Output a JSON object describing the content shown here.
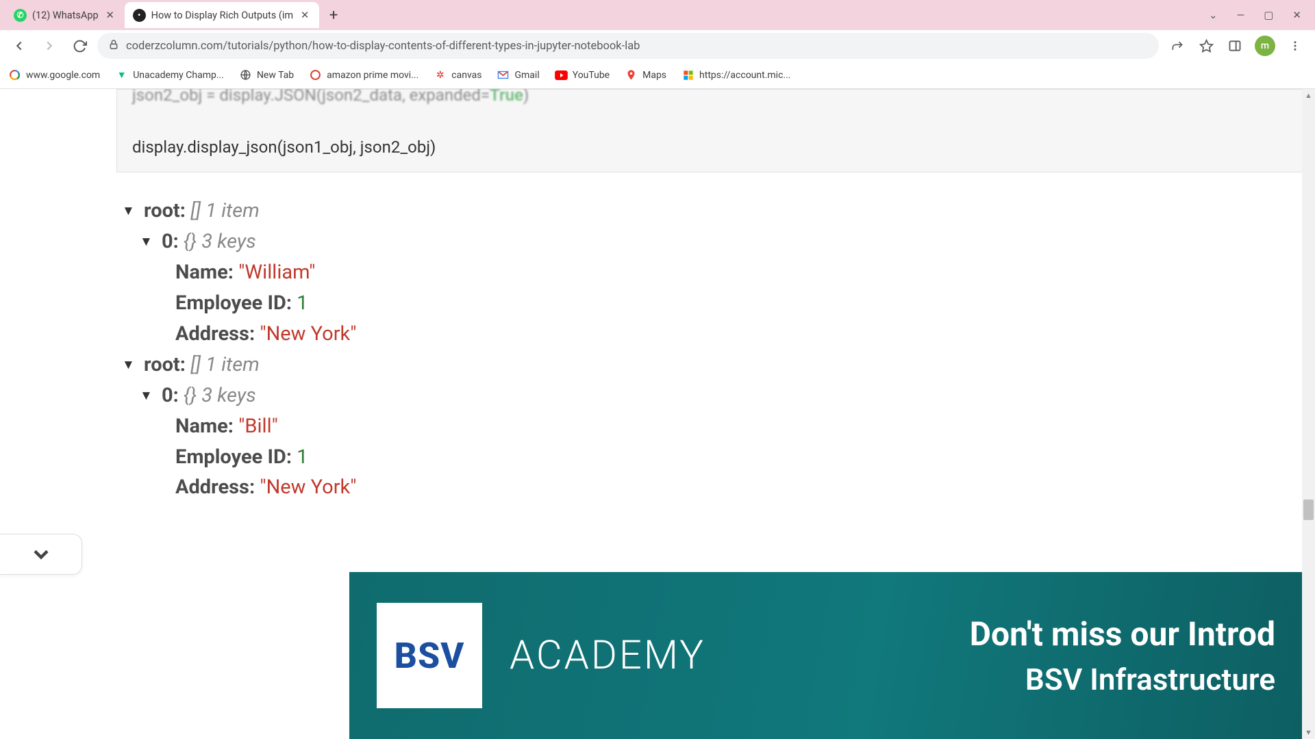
{
  "tabs": [
    {
      "title": "(12) WhatsApp",
      "favicon_bg": "#25d366",
      "favicon_text": "⊕"
    },
    {
      "title": "How to Display Rich Outputs (im",
      "favicon_bg": "#222",
      "favicon_text": "●"
    }
  ],
  "addr": {
    "url": "coderzcolumn.com/tutorials/python/how-to-display-contents-of-different-types-in-jupyter-notebook-lab"
  },
  "avatar_letter": "m",
  "bookmarks": [
    {
      "label": "www.google.com"
    },
    {
      "label": "Unacademy Champ..."
    },
    {
      "label": "New Tab"
    },
    {
      "label": "amazon prime movi..."
    },
    {
      "label": "canvas"
    },
    {
      "label": "Gmail"
    },
    {
      "label": "YouTube"
    },
    {
      "label": "Maps"
    },
    {
      "label": "https://account.mic..."
    }
  ],
  "code": {
    "blur_line_a": "json2_obj = display.JSON(json2_data, expanded=",
    "blur_true": "True",
    "blur_line_b": ")",
    "line2": "display.display_json(json1_obj, json2_obj)"
  },
  "json": {
    "root_label": "root:",
    "root_br": "[]",
    "root_meta": "1 item",
    "idx_label": "0:",
    "idx_br": "{}",
    "idx_meta": "3 keys",
    "obj1": {
      "name_k": "Name:",
      "name_v": "\"William\"",
      "eid_k": "Employee ID:",
      "eid_v": "1",
      "addr_k": "Address:",
      "addr_v": "\"New York\""
    },
    "obj2": {
      "name_k": "Name:",
      "name_v": "\"Bill\"",
      "eid_k": "Employee ID:",
      "eid_v": "1",
      "addr_k": "Address:",
      "addr_v": "\"New York\""
    }
  },
  "ad": {
    "logo": "BSV",
    "academy": "ACADEMY",
    "line1": "Don't miss our Introd",
    "line2": "BSV Infrastructure"
  }
}
